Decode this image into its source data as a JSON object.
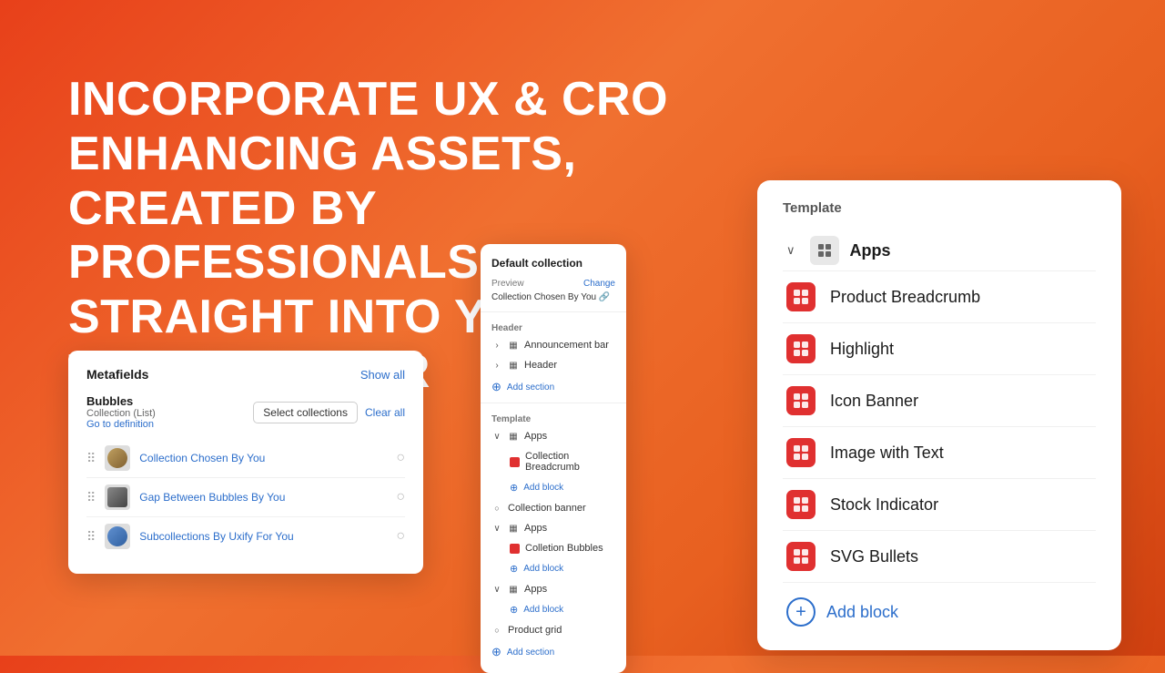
{
  "hero": {
    "line1": "INCORPORATE UX & CRO ENHANCING ASSETS,",
    "line2": "CREATED BY PROFESSIONALS,",
    "line3": "STRAIGHT INTO YOUR THEME EDITOR"
  },
  "metafields_card": {
    "title": "Metafields",
    "show_all": "Show all",
    "bubbles_label": "Bubbles",
    "bubbles_sub": "Collection (List)",
    "go_to_definition": "Go to definition",
    "select_collections": "Select collections",
    "clear_all": "Clear all",
    "rows": [
      {
        "label": "Collection Chosen By You"
      },
      {
        "label": "Gap Between Bubbles By You"
      },
      {
        "label": "Subcollections By Uxify For You"
      }
    ]
  },
  "theme_card": {
    "title": "Default collection",
    "preview_label": "Preview",
    "change_label": "Change",
    "collection_value": "Collection Chosen By You 🔗",
    "header_label": "Header",
    "announcement_bar": "Announcement bar",
    "header": "Header",
    "add_section": "Add section",
    "template_label": "Template",
    "apps_label": "Apps",
    "collection_breadcrumb": "Collection Breadcrumb",
    "add_block_1": "Add block",
    "collection_banner": "Collection banner",
    "apps_label2": "Apps",
    "collection_bubbles": "Colletion Bubbles",
    "add_block_2": "Add block",
    "apps_label3": "Apps",
    "add_block_3": "Add block",
    "product_grid": "Product grid",
    "add_section2": "Add section"
  },
  "right_panel": {
    "section_label": "Template",
    "apps_label": "Apps",
    "items": [
      {
        "label": "Product Breadcrumb"
      },
      {
        "label": "Highlight"
      },
      {
        "label": "Icon Banner"
      },
      {
        "label": "Image with Text"
      },
      {
        "label": "Stock Indicator"
      },
      {
        "label": "SVG Bullets"
      }
    ],
    "add_block": "Add block"
  }
}
